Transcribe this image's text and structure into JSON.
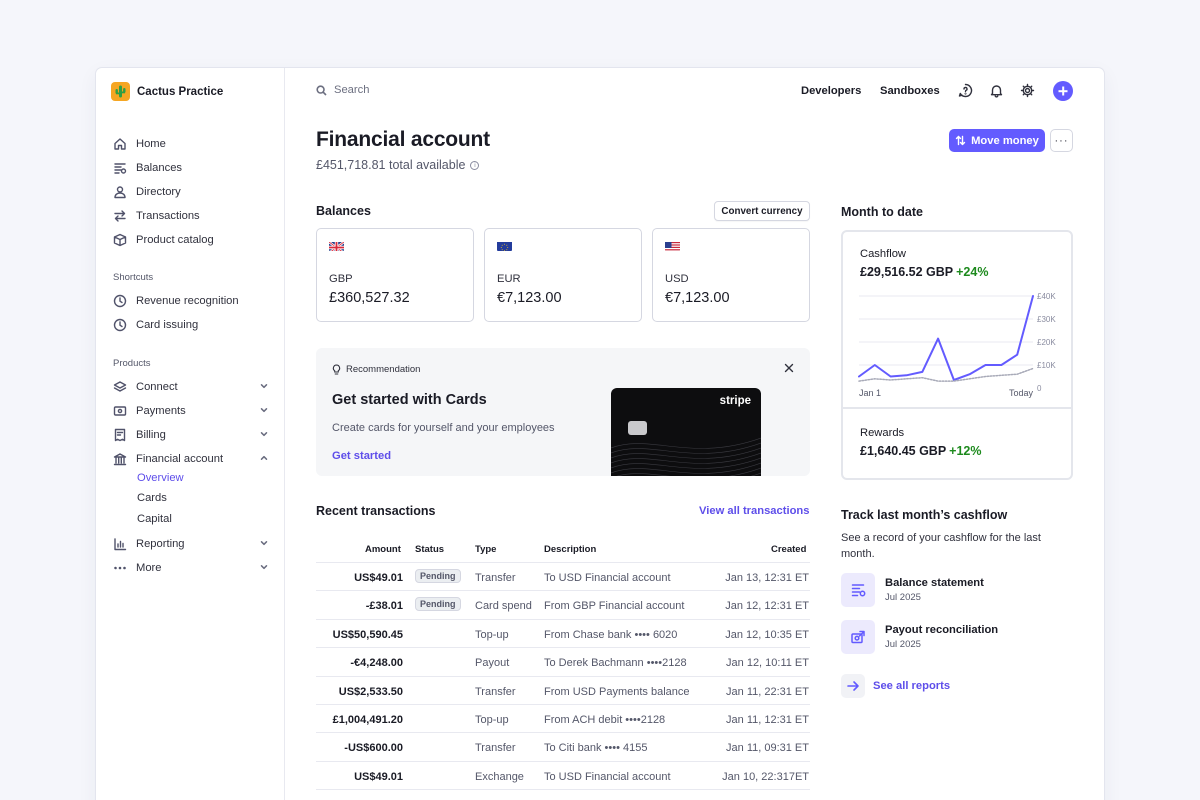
{
  "app": {
    "name": "Cactus Practice"
  },
  "sidebar": {
    "main_items": [
      {
        "label": "Home",
        "icon": "home-icon"
      },
      {
        "label": "Balances",
        "icon": "balances-icon"
      },
      {
        "label": "Directory",
        "icon": "user-icon"
      },
      {
        "label": "Transactions",
        "icon": "arrows-icon"
      },
      {
        "label": "Product catalog",
        "icon": "box-icon"
      }
    ],
    "shortcuts_label": "Shortcuts",
    "shortcuts": [
      {
        "label": "Revenue recognition",
        "icon": "clock-icon"
      },
      {
        "label": "Card issuing",
        "icon": "clock-icon"
      }
    ],
    "products_label": "Products",
    "products": [
      {
        "label": "Connect",
        "icon": "layers-icon",
        "expanded": false
      },
      {
        "label": "Payments",
        "icon": "card-icon",
        "expanded": false
      },
      {
        "label": "Billing",
        "icon": "receipt-icon",
        "expanded": false
      },
      {
        "label": "Financial account",
        "icon": "bank-icon",
        "expanded": true
      },
      {
        "label": "Reporting",
        "icon": "bar-chart-icon",
        "expanded": false
      },
      {
        "label": "More",
        "icon": "ellipsis-icon",
        "expanded": false
      }
    ],
    "financial_sub": [
      {
        "label": "Overview",
        "active": true
      },
      {
        "label": "Cards",
        "active": false
      },
      {
        "label": "Capital",
        "active": false
      }
    ]
  },
  "topbar": {
    "search_placeholder": "Search",
    "developers": "Developers",
    "sandboxes": "Sandboxes"
  },
  "header": {
    "title": "Financial account",
    "subtitle": "£451,718.81 total available",
    "info_glyph": "i",
    "move_money": "Move money",
    "more_glyph": "···"
  },
  "balances": {
    "title": "Balances",
    "convert": "Convert currency",
    "cards": [
      {
        "currency": "GBP",
        "amount": "£360,527.32",
        "flag": "uk-flag-icon"
      },
      {
        "currency": "EUR",
        "amount": "€7,123.00",
        "flag": "eu-flag-icon"
      },
      {
        "currency": "USD",
        "amount": "€7,123.00",
        "flag": "us-flag-icon"
      }
    ]
  },
  "recommendation": {
    "tag": "Recommendation",
    "title": "Get started with Cards",
    "description": "Create cards for yourself and your employees",
    "link": "Get started",
    "card_brand": "stripe"
  },
  "transactions": {
    "title": "Recent transactions",
    "view_all": "View all transactions",
    "columns": {
      "amount": "Amount",
      "status": "Status",
      "type": "Type",
      "description": "Description",
      "created": "Created"
    },
    "rows": [
      {
        "amount": "US$49.01",
        "status": "Pending",
        "type": "Transfer",
        "description": "To USD Financial account",
        "created": "Jan 13, 12:31 ET"
      },
      {
        "amount": "-£38.01",
        "status": "Pending",
        "type": "Card spend",
        "description": "From GBP Financial account",
        "created": "Jan 12, 12:31 ET"
      },
      {
        "amount": "US$50,590.45",
        "status": "",
        "type": "Top-up",
        "description": "From Chase bank •••• 6020",
        "created": "Jan 12, 10:35 ET"
      },
      {
        "amount": "-€4,248.00",
        "status": "",
        "type": "Payout",
        "description": "To Derek Bachmann ••••2128",
        "created": "Jan 12, 10:11 ET"
      },
      {
        "amount": "US$2,533.50",
        "status": "",
        "type": "Transfer",
        "description": "From USD Payments balance",
        "created": "Jan 11, 22:31 ET"
      },
      {
        "amount": "£1,004,491.20",
        "status": "",
        "type": "Top-up",
        "description": "From ACH debit  ••••2128",
        "created": "Jan 11, 12:31 ET"
      },
      {
        "amount": "-US$600.00",
        "status": "",
        "type": "Transfer",
        "description": "To Citi bank •••• 4155",
        "created": "Jan 11, 09:31 ET"
      },
      {
        "amount": "US$49.01",
        "status": "",
        "type": "Exchange",
        "description": "To USD Financial account",
        "created": "Jan 10, 22:317ET"
      }
    ]
  },
  "month_to_date": {
    "title": "Month to date",
    "cashflow_label": "Cashflow",
    "cashflow_value": "£29,516.52 GBP",
    "cashflow_change": "+24%",
    "rewards_label": "Rewards",
    "rewards_value": "£1,640.45 GBP",
    "rewards_change": "+12%",
    "accent_color": "#635bff",
    "positive_color": "#1d8a1d"
  },
  "chart_data": {
    "type": "line",
    "x_start_label": "Jan 1",
    "x_end_label": "Today",
    "y_ticks": [
      "£40K",
      "£30K",
      "£20K",
      "£10K",
      "0"
    ],
    "ylim": [
      0,
      40000
    ],
    "series": [
      {
        "values": [
          5000,
          10000,
          5000,
          5500,
          7000,
          21500,
          3500,
          6000,
          10000,
          10000,
          14500,
          40000
        ]
      },
      {
        "values": [
          3000,
          4000,
          3500,
          4000,
          4500,
          3000,
          3000,
          4000,
          5000,
          5500,
          6000,
          8500
        ]
      }
    ]
  },
  "reports": {
    "title": "Track last month’s cashflow",
    "description": "See a record of your cashflow for the last month.",
    "items": [
      {
        "title": "Balance statement",
        "date": "Jul 2025"
      },
      {
        "title": "Payout reconciliation",
        "date": "Jul 2025"
      }
    ],
    "see_all": "See all reports"
  }
}
